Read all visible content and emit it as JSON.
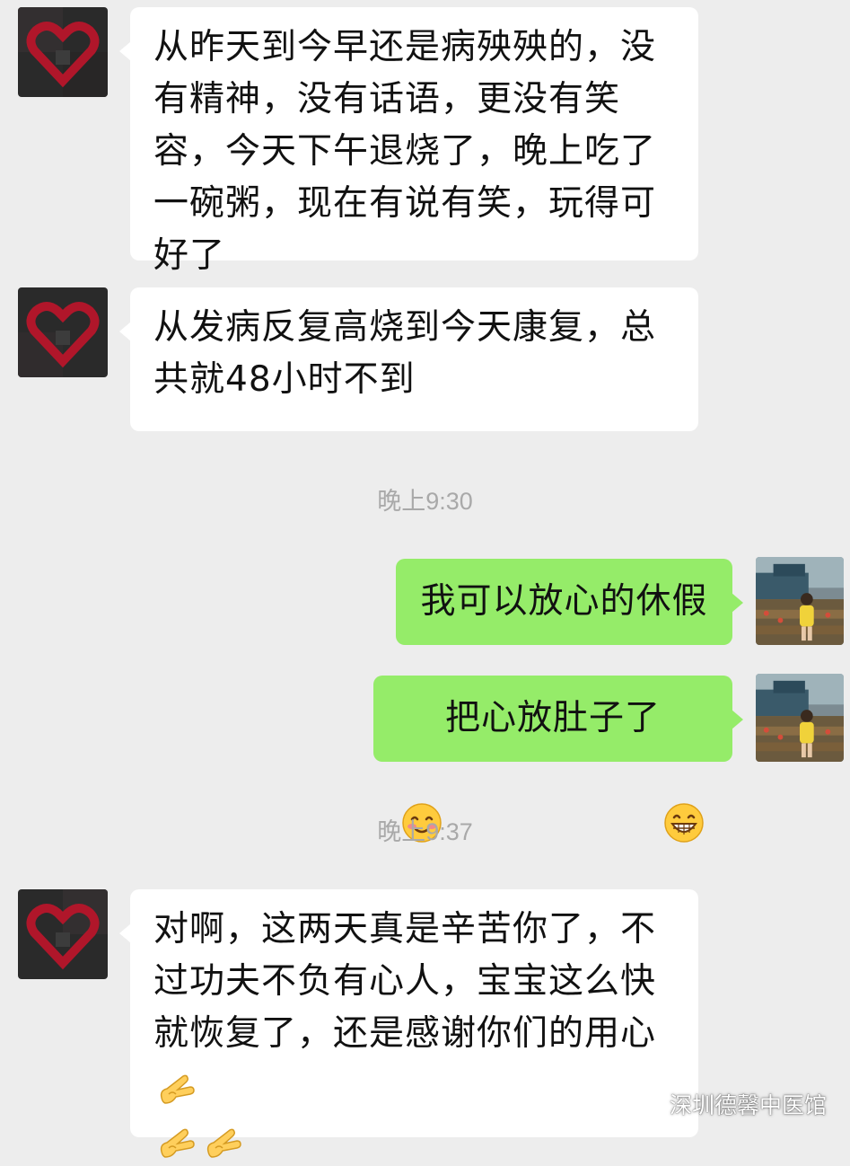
{
  "messages": [
    {
      "side": "left",
      "text": "从昨天到今早还是病殃殃的，没有精神，没有话语，更没有笑容，今天下午退烧了，晚上吃了一碗粥，现在有说有笑，玩得可好了"
    },
    {
      "side": "left",
      "text": "从发病反复高烧到今天康复，总共就48小时不到"
    },
    {
      "side": "timestamp",
      "text": "晚上9:30"
    },
    {
      "side": "right",
      "text": "我可以放心的休假"
    },
    {
      "side": "right",
      "text": "把心放肚子了",
      "emoji_before": "smiling-blush-emoji",
      "emoji_after": "grinning-emoji"
    },
    {
      "side": "timestamp",
      "text": "晚上9:37"
    },
    {
      "side": "left",
      "text": "对啊，这两天真是辛苦你了，不过功夫不负有心人，宝宝这么快就恢复了，还是感谢你们的用心",
      "trailing_emoji": "ok-hand-emoji",
      "emoji_line": [
        "ok-hand-emoji",
        "ok-hand-emoji"
      ]
    }
  ],
  "watermark": {
    "icon": "wechat-official-account-icon",
    "text": "深圳德馨中医馆"
  },
  "colors": {
    "background": "#ededed",
    "incoming_bubble": "#ffffff",
    "outgoing_bubble": "#95ec69",
    "timestamp": "#a9a9a9"
  }
}
